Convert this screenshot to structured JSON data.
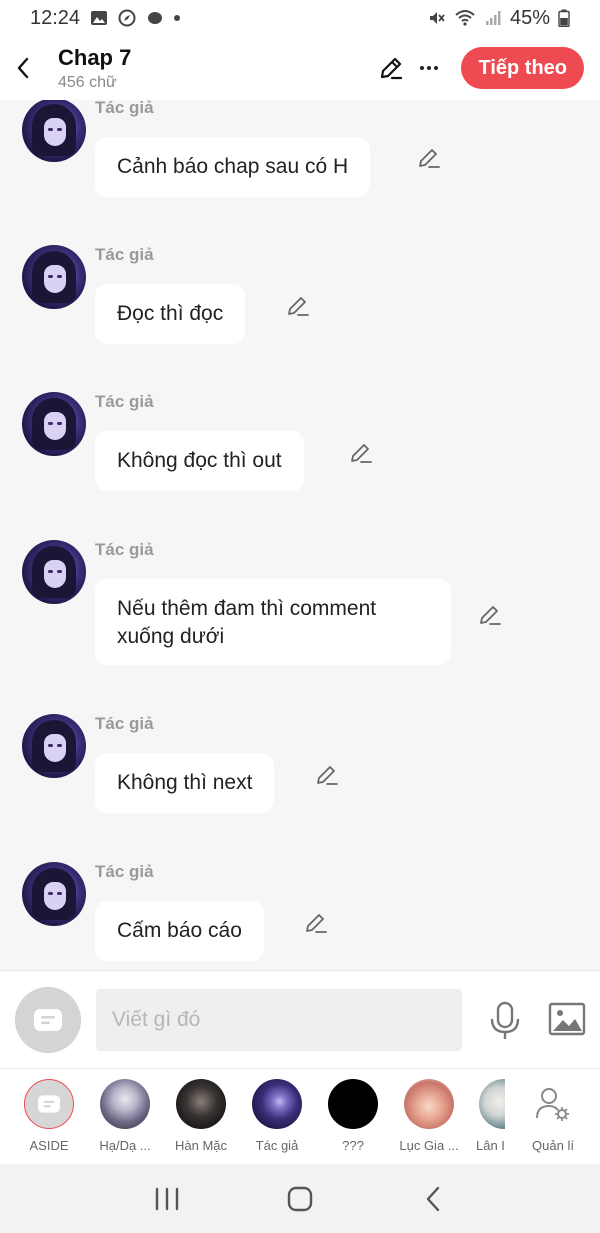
{
  "status_bar": {
    "time": "12:24",
    "battery": "45%"
  },
  "header": {
    "title": "Chap 7",
    "subtitle": "456 chữ",
    "next_button": "Tiếp theo"
  },
  "messages": [
    {
      "sender": "Tác giả",
      "text": "Cảnh báo chap sau có H"
    },
    {
      "sender": "Tác giả",
      "text": "Đọc thì đọc"
    },
    {
      "sender": "Tác giả",
      "text": "Không đọc thì out"
    },
    {
      "sender": "Tác giả",
      "text": "Nếu thêm đam thì comment\nxuống dưới"
    },
    {
      "sender": "Tác giả",
      "text": "Không thì next"
    },
    {
      "sender": "Tác giả",
      "text": "Cấm báo cáo"
    }
  ],
  "input": {
    "placeholder": "Viết gì đó"
  },
  "characters": [
    {
      "label": "ASIDE"
    },
    {
      "label": "Hạ/Dạ ..."
    },
    {
      "label": "Hàn Mặc"
    },
    {
      "label": "Tác giả"
    },
    {
      "label": "???"
    },
    {
      "label": "Lục Gia ..."
    },
    {
      "label": "Lân I"
    },
    {
      "label": "Quản lí"
    }
  ],
  "colors": {
    "accent": "#ee4a52",
    "background": "#f6f6f6",
    "bubble": "#ffffff"
  }
}
